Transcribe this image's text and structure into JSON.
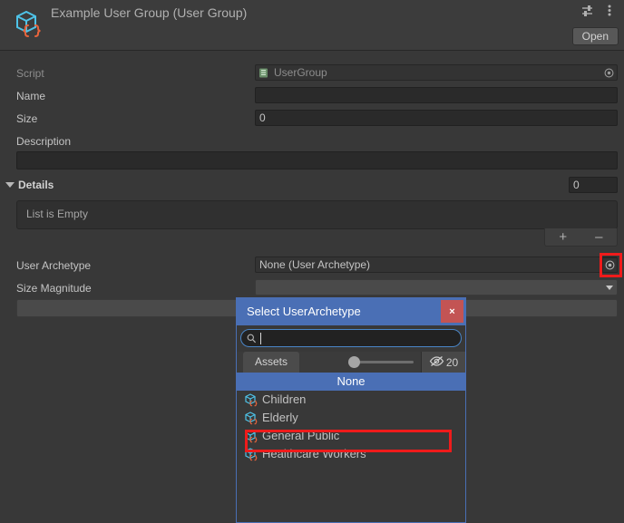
{
  "header": {
    "title": "Example User Group (User Group)",
    "icon": "scriptable-object-icon",
    "preset_icon": "preset-sliders-icon",
    "menu_icon": "vertical-dots-icon",
    "open_label": "Open"
  },
  "properties": {
    "script": {
      "label": "Script",
      "value": "UserGroup",
      "icon": "csharp-script-icon",
      "picker_icon": "object-picker-icon"
    },
    "name": {
      "label": "Name",
      "value": ""
    },
    "size": {
      "label": "Size",
      "value": "0"
    },
    "description": {
      "label": "Description",
      "value": ""
    }
  },
  "details": {
    "label": "Details",
    "arrow_icon": "foldout-expanded-icon",
    "size_value": "0",
    "empty_text": "List is Empty",
    "add_label": "+",
    "remove_label": "–"
  },
  "user_archetype": {
    "label": "User Archetype",
    "value": "None (User Archetype)",
    "picker_icon": "object-picker-icon"
  },
  "size_magnitude": {
    "label": "Size Magnitude",
    "value": "",
    "dropdown_icon": "chevron-down-icon"
  },
  "extra_field": {
    "value": ""
  },
  "picker_dialog": {
    "title": "Select UserArchetype",
    "close_label": "×",
    "close_icon": "close-icon",
    "search_placeholder": "",
    "search_value": "",
    "search_icon": "search-icon",
    "tab_assets": "Assets",
    "zoom_slider_value": 0,
    "visibility_icon": "eye-crossed-icon",
    "count": "20",
    "items": [
      {
        "label": "None",
        "selected": true,
        "icon": null
      },
      {
        "label": "Children",
        "selected": false,
        "icon": "scriptable-object-icon"
      },
      {
        "label": "Elderly",
        "selected": false,
        "icon": "scriptable-object-icon"
      },
      {
        "label": "General Public",
        "selected": false,
        "icon": "scriptable-object-icon",
        "highlighted": true
      },
      {
        "label": "Healthcare Workers",
        "selected": false,
        "icon": "scriptable-object-icon"
      }
    ]
  },
  "colors": {
    "background": "#383838",
    "header": "#3c3c3c",
    "accent_blue": "#4a6fb5",
    "close_red": "#c35454",
    "highlight_red": "#ef1b1b",
    "icon_blue": "#4ec3e8",
    "icon_orange": "#e8643c"
  }
}
